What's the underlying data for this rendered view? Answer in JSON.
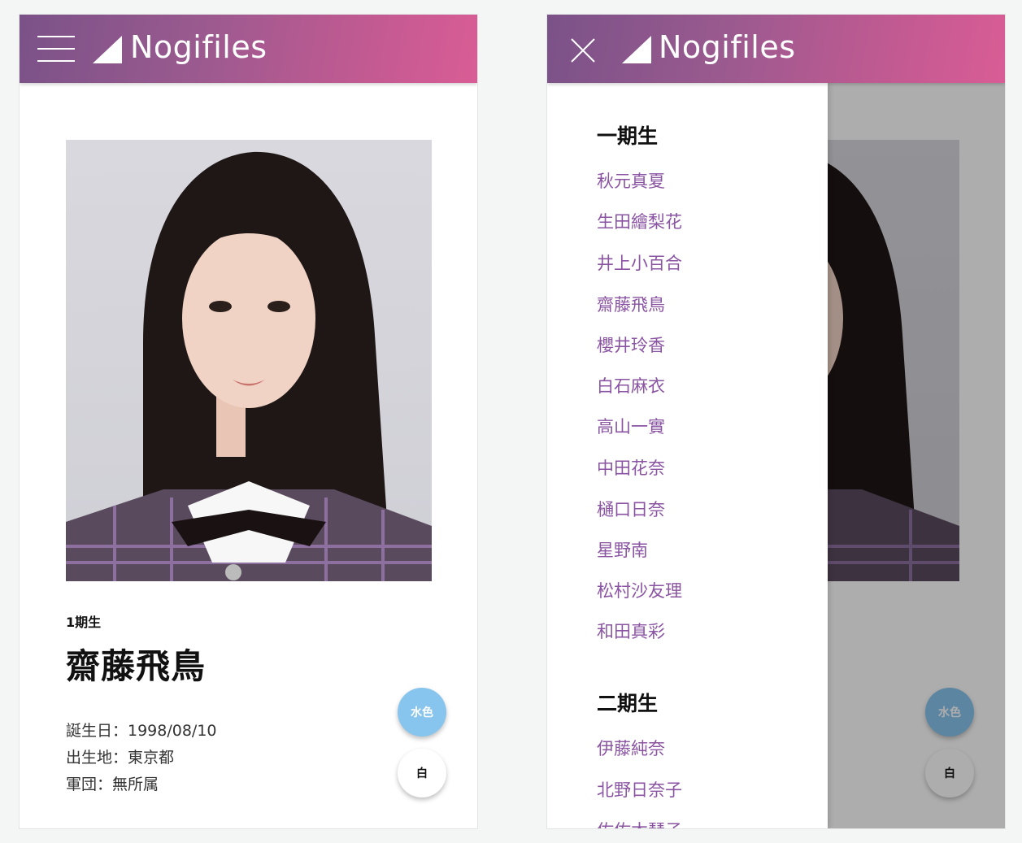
{
  "app": {
    "title": "Nogifiles"
  },
  "profile": {
    "generation": "1期生",
    "name": "齋藤飛鳥",
    "info": [
      "誕生日：1998/08/10",
      "出生地：東京都",
      "軍団：無所属"
    ]
  },
  "fabs": {
    "blue": "水色",
    "white": "白"
  },
  "drawer": {
    "sections": [
      {
        "heading": "一期生",
        "items": [
          "秋元真夏",
          "生田繪梨花",
          "井上小百合",
          "齋藤飛鳥",
          "櫻井玲香",
          "白石麻衣",
          "高山一實",
          "中田花奈",
          "樋口日奈",
          "星野南",
          "松村沙友理",
          "和田真彩"
        ]
      },
      {
        "heading": "二期生",
        "items": [
          "伊藤純奈",
          "北野日奈子",
          "佐佐木琴子"
        ]
      }
    ]
  },
  "colors": {
    "accent": "#8a54a3",
    "bar_start": "#7a5288",
    "bar_end": "#d95c95",
    "fab_blue": "#87c5ee"
  },
  "icons": {
    "menu": "hamburger-icon",
    "close": "close-icon",
    "logo": "triangle-logo-icon"
  }
}
